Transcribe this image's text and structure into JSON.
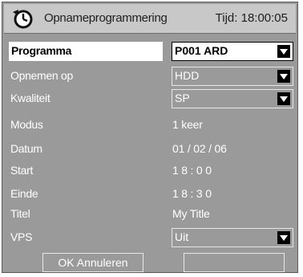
{
  "titlebar": {
    "icon": "recording-timer-icon",
    "title": "Opnameprogrammering",
    "clock": "Tijd: 18:00:05"
  },
  "fields": {
    "programma": {
      "label": "Programma",
      "value": "P001 ARD"
    },
    "opnemen_op": {
      "label": "Opnemen op",
      "value": "HDD"
    },
    "kwaliteit": {
      "label": "Kwaliteit",
      "value": "SP"
    },
    "modus": {
      "label": "Modus",
      "value": "1 keer"
    },
    "datum": {
      "label": "Datum",
      "value": "01 / 02 / 06"
    },
    "start": {
      "label": "Start",
      "value": "1 8 : 0 0"
    },
    "einde": {
      "label": "Einde",
      "value": "1 8 : 3 0"
    },
    "titel": {
      "label": "Titel",
      "value": "My Title"
    },
    "vps": {
      "label": "VPS",
      "value": "Uit"
    }
  },
  "buttons": {
    "ok_cancel": "OK Annuleren",
    "blank": ""
  }
}
